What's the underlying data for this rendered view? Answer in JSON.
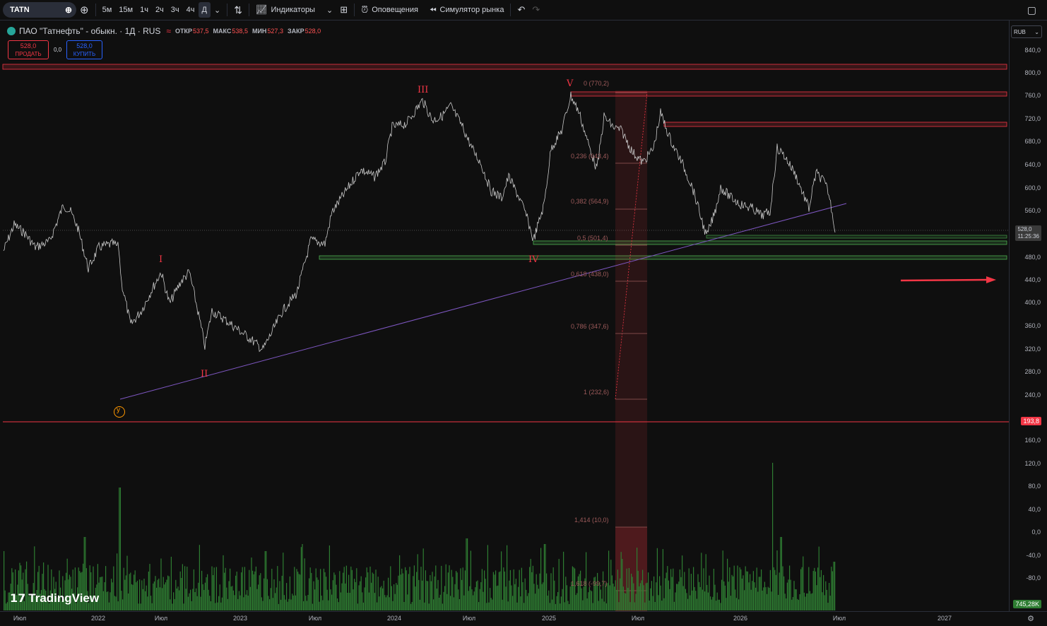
{
  "toolbar": {
    "symbol": "TATN",
    "intervals": [
      "5м",
      "15м",
      "1ч",
      "2ч",
      "3ч",
      "4ч",
      "Д"
    ],
    "active_interval": "Д",
    "indicators_label": "Индикаторы",
    "alerts_label": "Оповещения",
    "replay_label": "Симулятор рынка"
  },
  "legend": {
    "title": "ПАО \"Татнефть\" - обыкн. · 1Д · RUS",
    "open_label": "ОТКР",
    "open": "537,5",
    "high_label": "МАКС",
    "high": "538,5",
    "low_label": "МИН",
    "low": "527,3",
    "close_label": "ЗАКР",
    "close": "528,0"
  },
  "trade": {
    "sell_price": "528,0",
    "sell_label": "ПРОДАТЬ",
    "spread": "0,0",
    "buy_price": "528,0",
    "buy_label": "КУПИТЬ"
  },
  "currency": "RUB",
  "price_scale": [
    "840,0",
    "800,0",
    "760,0",
    "720,0",
    "680,0",
    "640,0",
    "600,0",
    "560,0",
    "480,0",
    "440,0",
    "400,0",
    "360,0",
    "320,0",
    "280,0",
    "240,0",
    "160,0",
    "120,0",
    "80,0",
    "40,0",
    "0,0",
    "-40,0",
    "-80,0"
  ],
  "last_price": {
    "value": "528,0",
    "countdown": "11:25:36"
  },
  "level_badge": "193,8",
  "volume_badge": "745,28K",
  "time_axis": [
    "Июл",
    "2022",
    "Июл",
    "2023",
    "Июл",
    "2024",
    "Июл",
    "2025",
    "Июл",
    "2026",
    "Июл",
    "2027"
  ],
  "waves": [
    "I",
    "II",
    "III",
    "IV",
    "V",
    "y"
  ],
  "fib_levels": [
    "0 (770,2)",
    "0,236 (643,4)",
    "0,382 (564,9)",
    "0,5 (501,4)",
    "0,618 (438,0)",
    "0,786 (347,6)",
    "1 (232,6)",
    "1,414 (10,0)",
    "1,618 (-99,7)"
  ],
  "branding": "TradingView",
  "colors": {
    "resistance": "#f23645",
    "support": "#4caf50",
    "trendline": "#7e57c2",
    "volume": "#2e7d32",
    "price_line": "#c8c8c8"
  }
}
